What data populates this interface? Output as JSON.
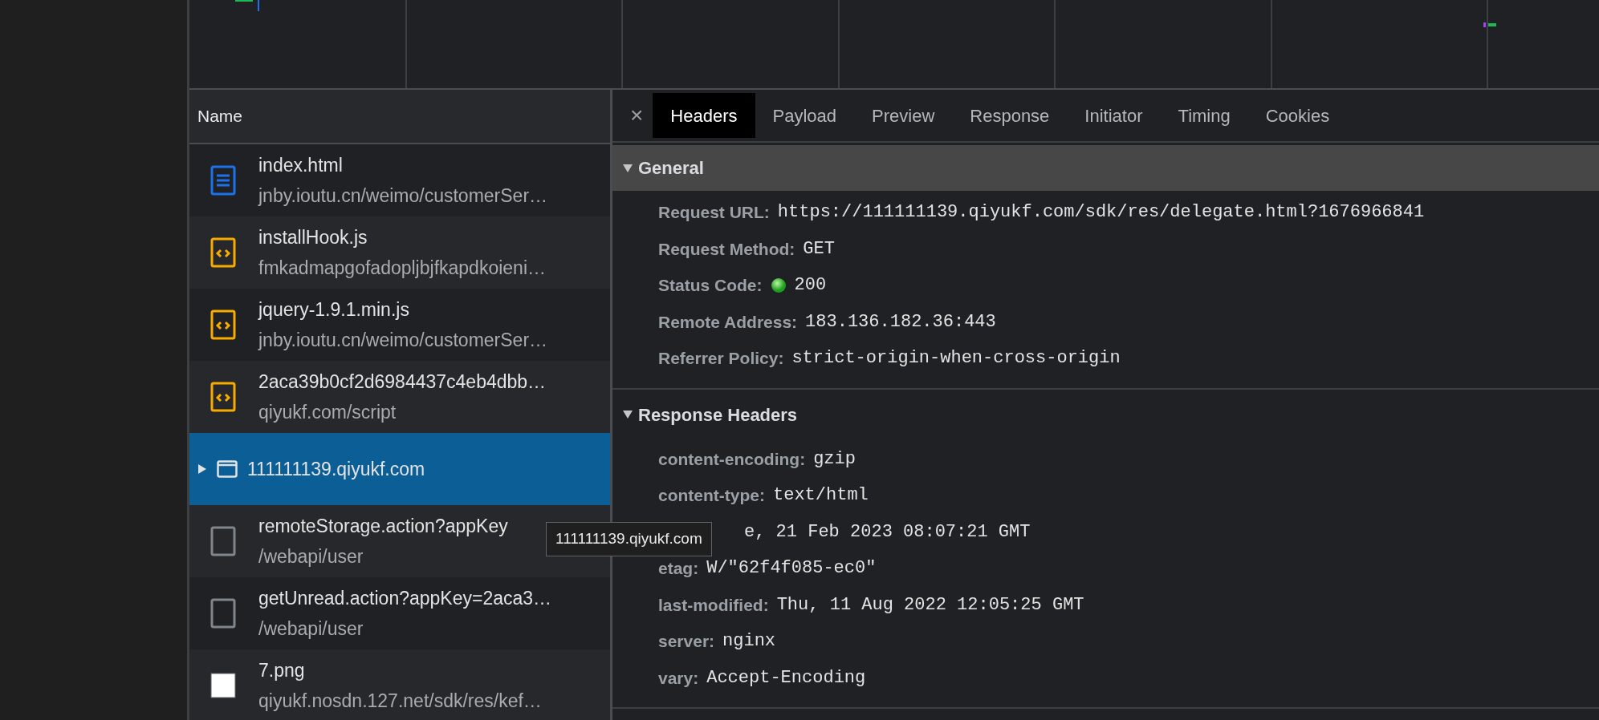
{
  "requests_panel": {
    "column_header": "Name",
    "rows": [
      {
        "kind": "document",
        "name": "index.html",
        "path": "jnby.ioutu.cn/weimo/customerSer…",
        "selected": false
      },
      {
        "kind": "script",
        "name": "installHook.js",
        "path": "fmkadmapgofadopljbjfkapdkoieni…",
        "selected": false
      },
      {
        "kind": "script",
        "name": "jquery-1.9.1.min.js",
        "path": "jnby.ioutu.cn/weimo/customerSer…",
        "selected": false
      },
      {
        "kind": "script",
        "name": "2aca39b0cf2d6984437c4eb4dbb…",
        "path": "qiyukf.com/script",
        "selected": false
      },
      {
        "kind": "frame",
        "name": "111111139.qiyukf.com",
        "selected": true,
        "expanded": false
      },
      {
        "kind": "fetch",
        "name": "remoteStorage.action?appKey",
        "path": "/webapi/user",
        "selected": false
      },
      {
        "kind": "fetch",
        "name": "getUnread.action?appKey=2aca3…",
        "path": "/webapi/user",
        "selected": false
      },
      {
        "kind": "image",
        "name": "7.png",
        "path": "qiyukf.nosdn.127.net/sdk/res/kef…",
        "selected": false
      }
    ]
  },
  "tooltip": "111111139.qiyukf.com",
  "details": {
    "close": "×",
    "tabs": [
      {
        "label": "Headers",
        "selected": true
      },
      {
        "label": "Payload",
        "selected": false
      },
      {
        "label": "Preview",
        "selected": false
      },
      {
        "label": "Response",
        "selected": false
      },
      {
        "label": "Initiator",
        "selected": false
      },
      {
        "label": "Timing",
        "selected": false
      },
      {
        "label": "Cookies",
        "selected": false
      }
    ],
    "sections": [
      {
        "title": "General",
        "expanded": true,
        "highlighted": true,
        "rows": [
          {
            "kind": "field",
            "name": "Request URL:",
            "value": "https://111111139.qiyukf.com/sdk/res/delegate.html?1676966841"
          },
          {
            "kind": "field",
            "name": "Request Method:",
            "value": "GET"
          },
          {
            "kind": "status",
            "name": "Status Code:",
            "value": "200"
          },
          {
            "kind": "field",
            "name": "Remote Address:",
            "value": "183.136.182.36:443"
          },
          {
            "kind": "field",
            "name": "Referrer Policy:",
            "value": "strict-origin-when-cross-origin"
          }
        ]
      },
      {
        "title": "Response Headers",
        "expanded": true,
        "highlighted": false,
        "rows": [
          {
            "kind": "field",
            "name": "content-encoding:",
            "value": "gzip"
          },
          {
            "kind": "field",
            "name": "content-type:",
            "value": "text/html"
          },
          {
            "kind": "covered",
            "value": "e, 21 Feb 2023 08:07:21 GMT"
          },
          {
            "kind": "field",
            "name": "etag:",
            "value": "W/\"62f4f085-ec0\""
          },
          {
            "kind": "field",
            "name": "last-modified:",
            "value": "Thu, 11 Aug 2022 12:05:25 GMT"
          },
          {
            "kind": "field",
            "name": "server:",
            "value": "nginx"
          },
          {
            "kind": "field",
            "name": "vary:",
            "value": "Accept-Encoding"
          }
        ]
      }
    ]
  }
}
